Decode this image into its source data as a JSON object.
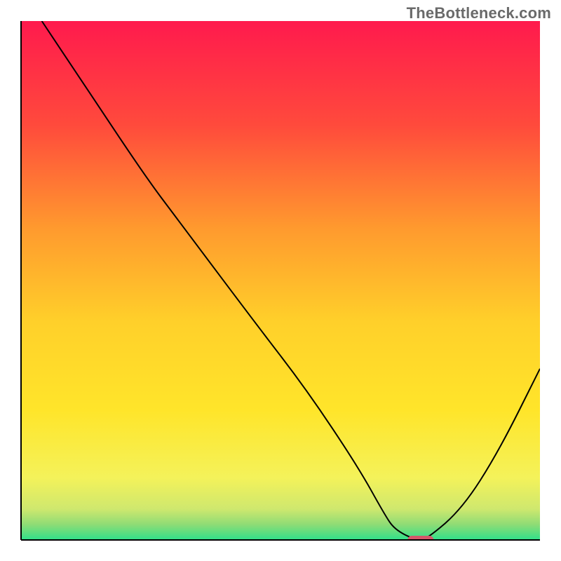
{
  "watermark": "TheBottleneck.com",
  "chart_data": {
    "type": "line",
    "title": "",
    "xlabel": "",
    "ylabel": "",
    "xlim": [
      0,
      100
    ],
    "ylim": [
      0,
      100
    ],
    "legend": false,
    "grid": false,
    "background": {
      "type": "vertical-gradient",
      "stops": [
        {
          "offset": 0.0,
          "color": "#ff1a4d"
        },
        {
          "offset": 0.2,
          "color": "#ff4a3c"
        },
        {
          "offset": 0.4,
          "color": "#ff9a2e"
        },
        {
          "offset": 0.58,
          "color": "#ffd02a"
        },
        {
          "offset": 0.75,
          "color": "#ffe52a"
        },
        {
          "offset": 0.88,
          "color": "#f4f25a"
        },
        {
          "offset": 0.94,
          "color": "#cfe86e"
        },
        {
          "offset": 0.97,
          "color": "#8fdc75"
        },
        {
          "offset": 1.0,
          "color": "#2fe08a"
        }
      ]
    },
    "series": [
      {
        "name": "bottleneck-curve",
        "color": "#000000",
        "width": 2,
        "x": [
          4,
          12,
          24,
          30,
          45,
          55,
          65,
          70,
          72,
          76,
          78,
          85,
          92,
          100
        ],
        "values": [
          100,
          88,
          70,
          62,
          42,
          29,
          14,
          5,
          2,
          0,
          0,
          6,
          17,
          33
        ]
      }
    ],
    "marker": {
      "name": "optimal-point",
      "shape": "rounded-rect",
      "color": "#d4596a",
      "x": 77,
      "y": 0,
      "width": 5,
      "height": 2
    },
    "axes": {
      "color": "#000000",
      "width": 2
    }
  }
}
